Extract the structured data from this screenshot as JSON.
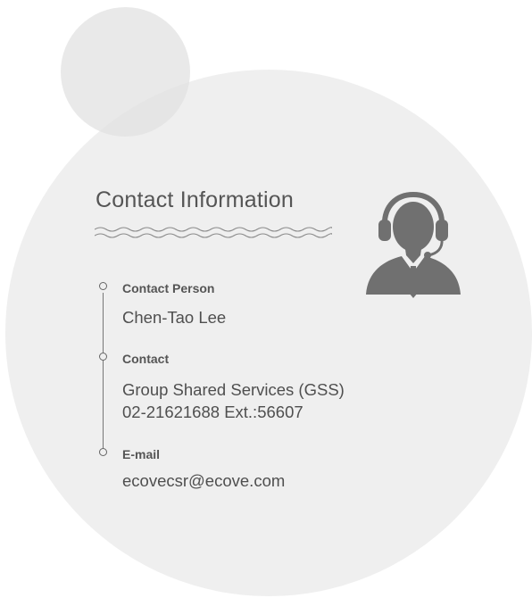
{
  "card": {
    "title": "Contact Information",
    "avatar_icon": "customer-service-headset-icon"
  },
  "contacts": {
    "person": {
      "label": "Contact Person",
      "value": "Chen-Tao Lee"
    },
    "contact": {
      "label": "Contact",
      "line1": "Group Shared Services (GSS)",
      "line2": "02-21621688 Ext.:56607"
    },
    "email": {
      "label": "E-mail",
      "value": "ecovecsr@ecove.com"
    }
  },
  "colors": {
    "background_circle": "#efefef",
    "accent_circle": "#e1e1e1",
    "icon": "#707070",
    "text": "#4f4f4f"
  }
}
